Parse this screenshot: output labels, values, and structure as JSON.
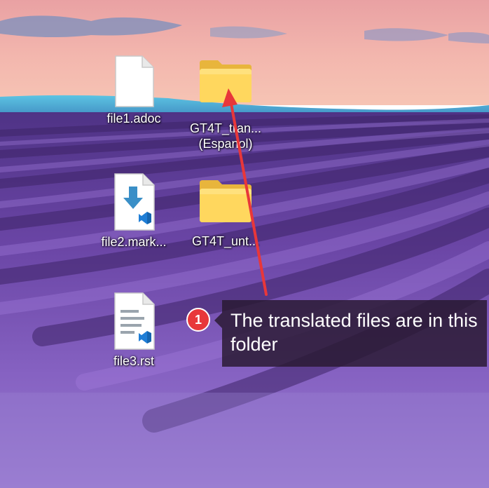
{
  "desktop": {
    "icons": [
      {
        "label": "file1.adoc",
        "type": "document"
      },
      {
        "label": "GT4T_tran...",
        "label_line2": "(Espanol)",
        "type": "folder"
      },
      {
        "label": "file2.mark...",
        "type": "markdown-vscode"
      },
      {
        "label": "GT4T_unt...",
        "type": "folder"
      },
      {
        "label": "file3.rst",
        "type": "rst-vscode"
      }
    ]
  },
  "tutorial": {
    "step_number": "1",
    "callout_text": "The translated files are in this folder",
    "badge_color": "#e8373a",
    "arrow_color": "#e8373a"
  },
  "colors": {
    "folder_yellow": "#ffd75e",
    "vscode_blue": "#1f7ed6"
  }
}
